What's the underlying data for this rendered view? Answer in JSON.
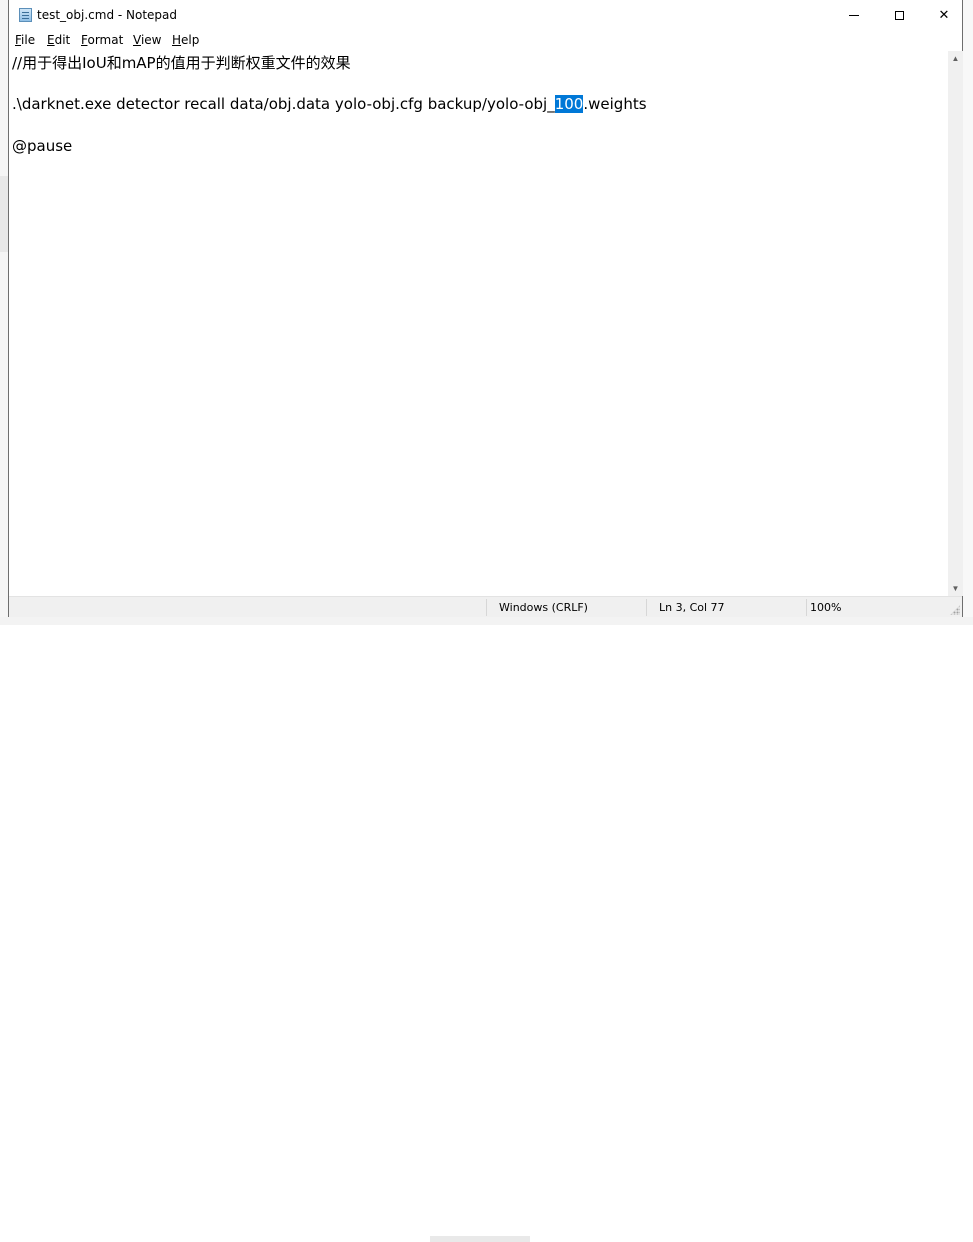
{
  "window": {
    "title": "test_obj.cmd - Notepad"
  },
  "controls": {
    "minimize_icon": "minimize-icon",
    "maximize_icon": "maximize-icon",
    "close_glyph": "✕"
  },
  "menu": {
    "items": [
      {
        "mnemonic": "F",
        "rest": "ile"
      },
      {
        "mnemonic": "E",
        "rest": "dit"
      },
      {
        "mnemonic": "F",
        "rest": "ormat",
        "prefix": ""
      },
      {
        "mnemonic": "V",
        "rest": "iew"
      },
      {
        "mnemonic": "H",
        "rest": "elp"
      }
    ]
  },
  "editor": {
    "line1": "//用于得出IoU和mAP的值用于判断权重文件的效果",
    "line2_before": ".\\darknet.exe detector recall data/obj.data yolo-obj.cfg backup/yolo-obj_",
    "line2_selected": "100",
    "line2_after": ".weights",
    "line3": "@pause"
  },
  "status": {
    "encoding": "Windows (CRLF)",
    "position": "Ln 3, Col 77",
    "zoom": "100%"
  },
  "colors": {
    "selection": "#0078d7",
    "statusbar": "#f0f0f0"
  }
}
